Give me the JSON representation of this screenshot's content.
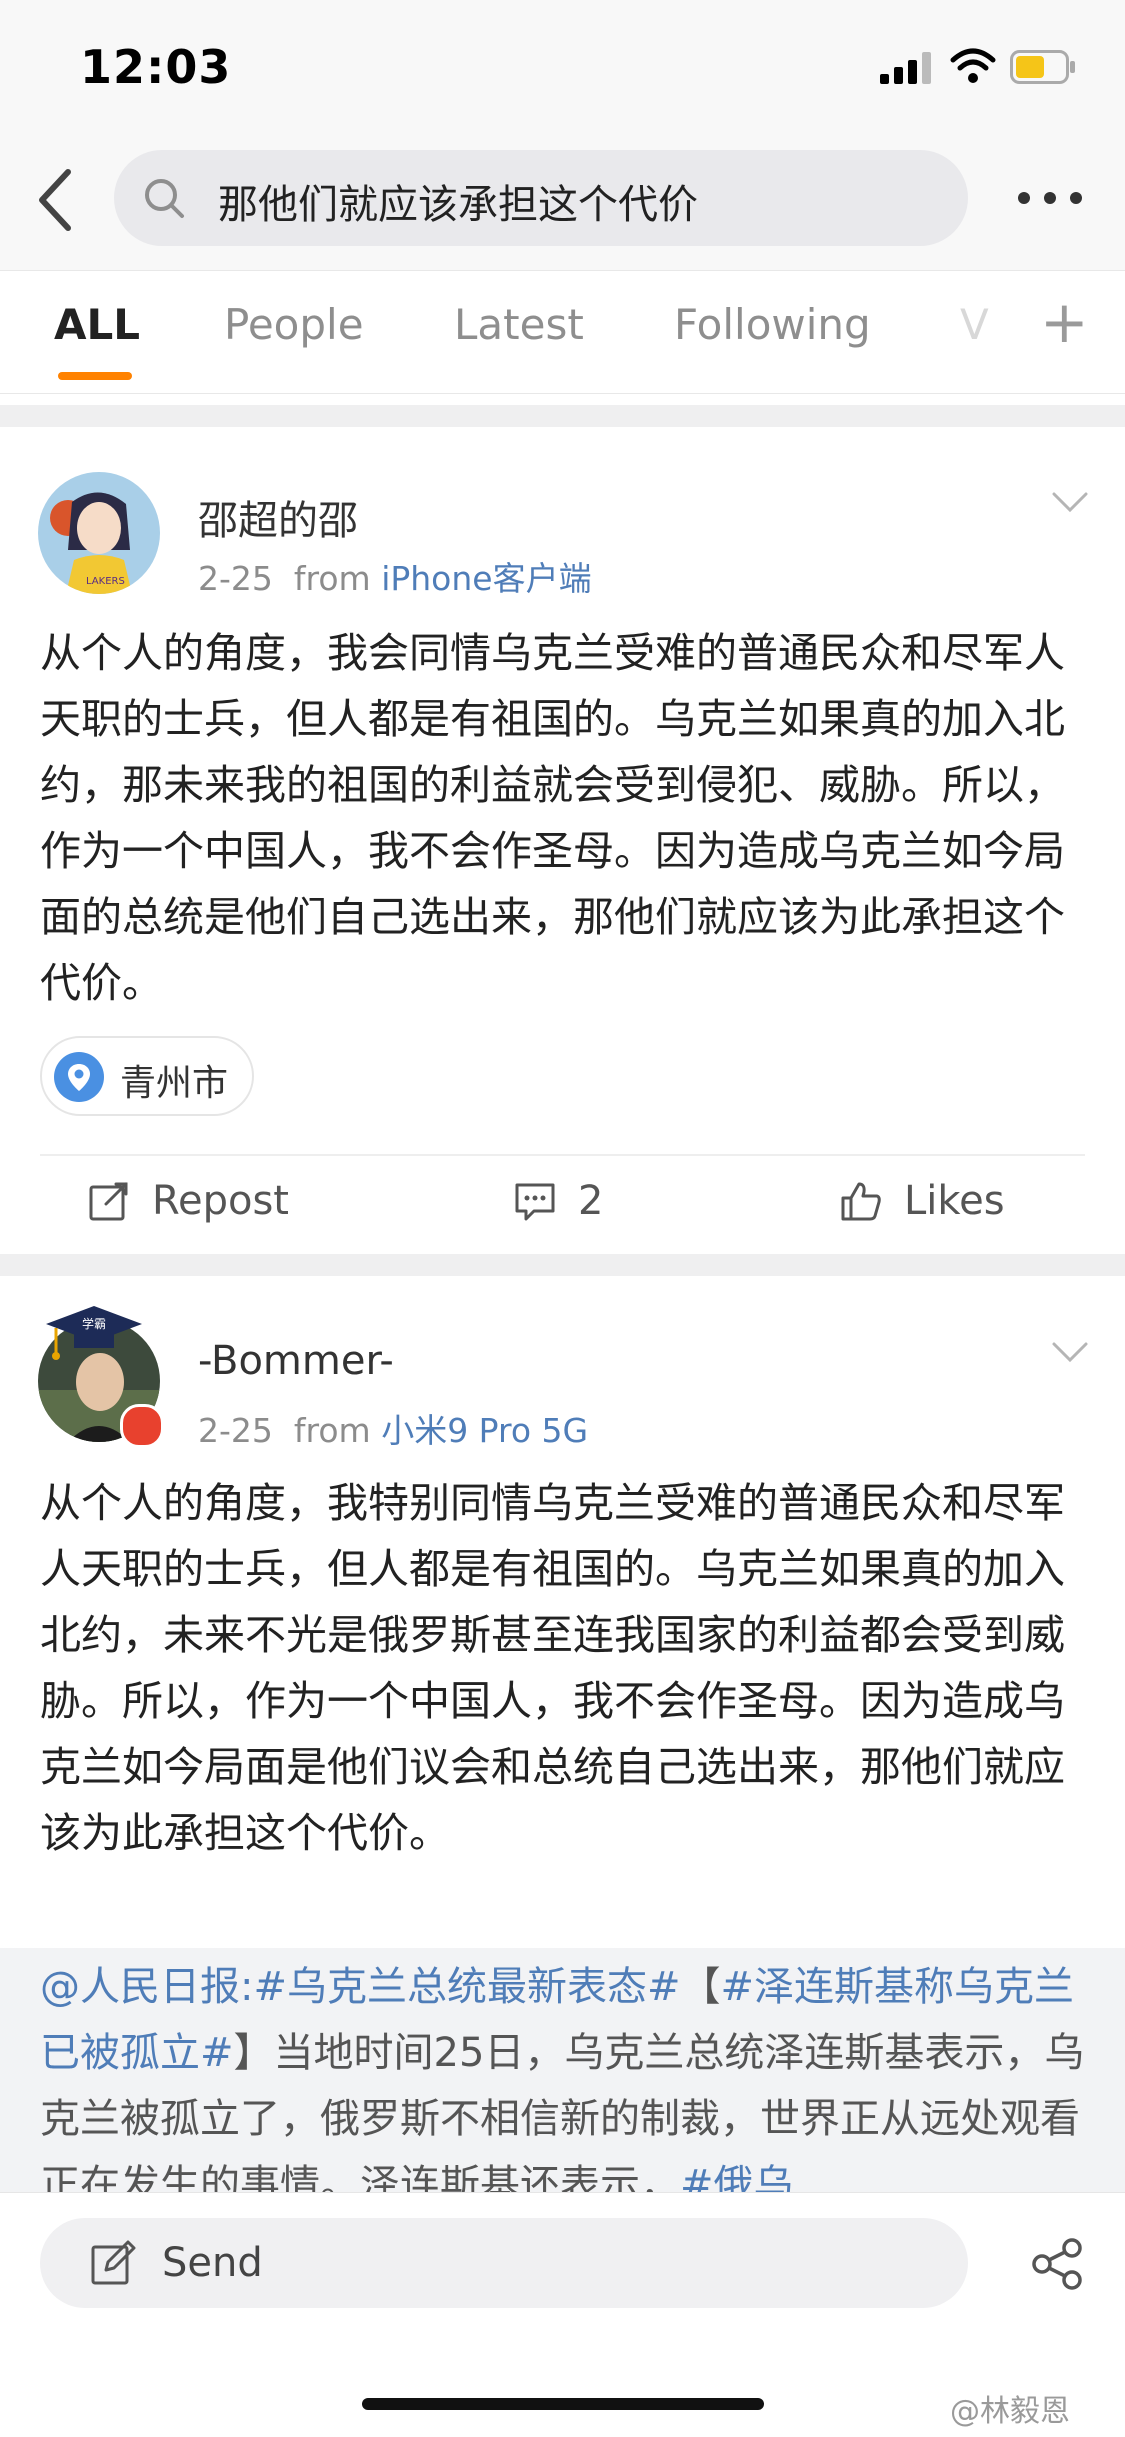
{
  "status_bar": {
    "time": "12:03"
  },
  "header": {
    "search_query": "那他们就应该承担这个代价"
  },
  "tabs": [
    {
      "label": "ALL",
      "active": true
    },
    {
      "label": "People",
      "active": false
    },
    {
      "label": "Latest",
      "active": false
    },
    {
      "label": "Following",
      "active": false
    }
  ],
  "tab_overflow": "V",
  "posts": [
    {
      "username": "邵超的邵",
      "date": "2-25",
      "from_word": "from",
      "source": "iPhone客户端",
      "text": "从个人的角度，我会同情乌克兰受难的普通民众和尽军人天职的士兵，但人都是有祖国的。乌克兰如果真的加入北约，那未来我的祖国的利益就会受到侵犯、威胁。所以，作为一个中国人，我不会作圣母。因为造成乌克兰如今局面的总统是他们自己选出来，那他们就应该为此承担这个代价。",
      "location": "青州市",
      "actions": {
        "repost": "Repost",
        "comments": "2",
        "likes": "Likes"
      }
    },
    {
      "username": "-Bommer-",
      "date": "2-25",
      "from_word": "from",
      "source": "小米9 Pro 5G",
      "text": "从个人的角度，我特别同情乌克兰受难的普通民众和尽军人天职的士兵，但人都是有祖国的。乌克兰如果真的加入北约，未来不光是俄罗斯甚至连我国家的利益都会受到威胁。所以，作为一个中国人，我不会作圣母。因为造成乌克兰如今局面是他们议会和总统自己选出来，那他们就应该为此承担这个代价。",
      "quote": {
        "mention": "@人民日报:",
        "tag1": "#乌克兰总统最新表态#",
        "bracket_open": "【",
        "tag2": "#泽连斯基称乌克兰已被孤立#",
        "body": "】当地时间25日，乌克兰总统泽连斯基表示，乌克兰被孤立了，俄罗斯不相信新的制裁，世界正从远处观看正在发生的事情。泽连斯基还表示，",
        "tag3": "#俄乌"
      }
    }
  ],
  "bottom_bar": {
    "send_label": "Send"
  },
  "watermark": "@林毅恩",
  "colors": {
    "accent": "#ff8200",
    "link": "#4f7db8",
    "badge": "#e8412e"
  }
}
